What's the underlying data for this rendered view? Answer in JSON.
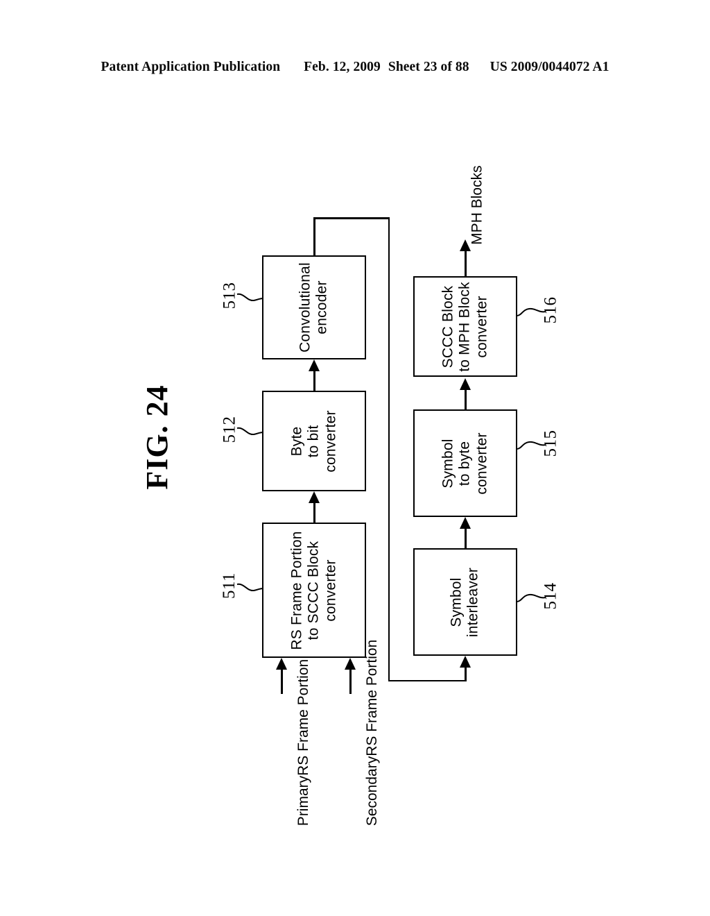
{
  "header": {
    "publication": "Patent Application Publication",
    "date": "Feb. 12, 2009",
    "sheet": "Sheet 23 of 88",
    "patent_number": "US 2009/0044072 A1"
  },
  "figure": {
    "title": "FIG. 24",
    "diagram_type": "block-diagram",
    "orientation": "rotated-90-ccw"
  },
  "blocks": [
    {
      "ref": "511",
      "label_lines": [
        "RS Frame Portion",
        "to SCCC Block",
        "converter"
      ],
      "label": "RS Frame Portion\nto SCCC Block\nconverter"
    },
    {
      "ref": "512",
      "label_lines": [
        "Byte",
        "to bit",
        "converter"
      ],
      "label": "Byte\nto bit\nconverter"
    },
    {
      "ref": "513",
      "label_lines": [
        "Convolutional",
        "encoder"
      ],
      "label": "Convolutional\nencoder"
    },
    {
      "ref": "514",
      "label_lines": [
        "Symbol",
        "interleaver"
      ],
      "label": "Symbol\ninterleaver"
    },
    {
      "ref": "515",
      "label_lines": [
        "Symbol",
        "to byte",
        "converter"
      ],
      "label": "Symbol\nto byte\nconverter"
    },
    {
      "ref": "516",
      "label_lines": [
        "SCCC Block",
        "to MPH Block",
        "converter"
      ],
      "label": "SCCC Block\nto MPH Block\nconverter"
    }
  ],
  "io_labels": {
    "input_primary": "Primary\nRS Frame Portion",
    "input_secondary": "Secondary\nRS Frame Portion",
    "output": "MPH Blocks"
  },
  "refs": {
    "r511": "511",
    "r512": "512",
    "r513": "513",
    "r514": "514",
    "r515": "515",
    "r516": "516"
  },
  "colors": {
    "ink": "#000000",
    "paper": "#ffffff"
  }
}
